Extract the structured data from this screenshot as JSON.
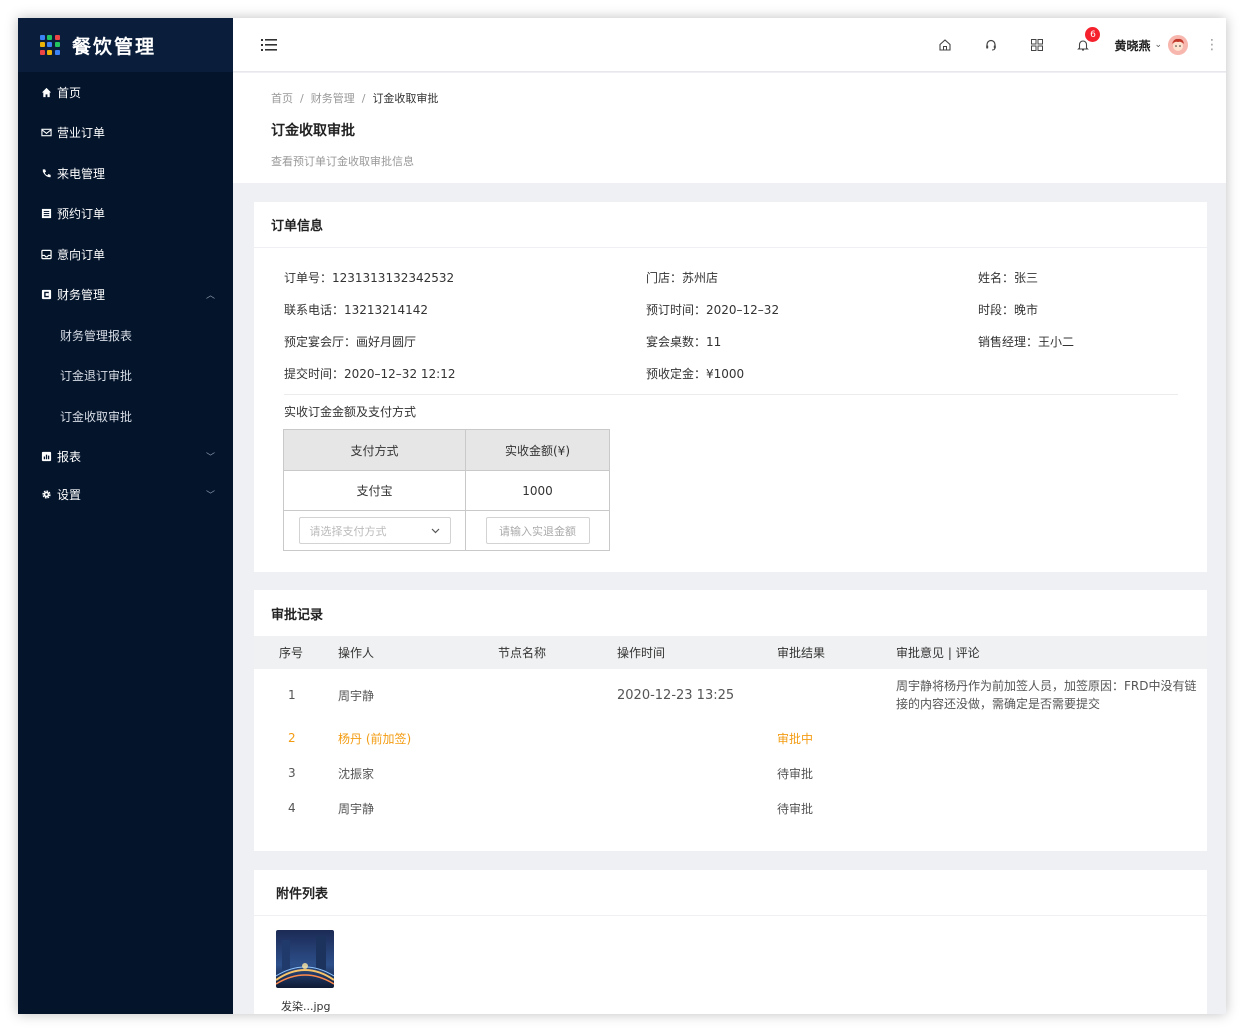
{
  "app": {
    "title": "餐饮管理"
  },
  "sidebar": {
    "items": [
      {
        "label": "首页",
        "icon": "home-icon"
      },
      {
        "label": "营业订单",
        "icon": "mail-icon"
      },
      {
        "label": "来电管理",
        "icon": "phone-icon"
      },
      {
        "label": "预约订单",
        "icon": "list-icon"
      },
      {
        "label": "意向订单",
        "icon": "inbox-icon"
      },
      {
        "label": "财务管理",
        "icon": "finance-icon",
        "expanded": true
      },
      {
        "label": "报表",
        "icon": "chart-icon"
      },
      {
        "label": "设置",
        "icon": "gear-icon"
      }
    ],
    "finance_children": [
      "财务管理报表",
      "订金退订审批",
      "订金收取审批"
    ]
  },
  "header": {
    "notification_count": "6",
    "user_name": "黄晓燕"
  },
  "breadcrumb": {
    "home": "首页",
    "parent": "财务管理",
    "current": "订金收取审批",
    "sep": "/"
  },
  "page": {
    "title": "订金收取审批",
    "description": "查看预订单订金收取审批信息"
  },
  "order_info": {
    "title": "订单信息",
    "fields": {
      "order_no": "订单号：1231313132342532",
      "store": "门店：苏州店",
      "name": "姓名：张三",
      "phone": "联系电话：13213214142",
      "book_time": "预订时间：2020–12–32",
      "period": "时段：晚市",
      "hall": "预定宴会厅：画好月圆厅",
      "tables": "宴会桌数：11",
      "sales_manager": "销售经理：王小二",
      "submit_time": "提交时间：2020–12–32 12:12",
      "deposit": "预收定金：¥1000"
    },
    "pay_caption": "实收订金金额及支付方式",
    "pay_table": {
      "headers": [
        "支付方式",
        "实收金额(¥)"
      ],
      "row": [
        "支付宝",
        "1000"
      ],
      "select_placeholder": "请选择支付方式",
      "amount_placeholder": "请输入实退金额"
    }
  },
  "approval": {
    "title": "审批记录",
    "headers": [
      "序号",
      "操作人",
      "节点名称",
      "操作时间",
      "审批结果",
      "审批意见 | 评论"
    ],
    "rows": [
      {
        "no": "1",
        "operator": "周宇静",
        "node": "",
        "time": "2020-12-23 13:25",
        "result": "",
        "comment": "周宇静将杨丹作为前加签人员，加签原因：FRD中没有链接的内容还没做，需确定是否需要提交"
      },
      {
        "no": "2",
        "operator": "杨丹 (前加签)",
        "node": "",
        "time": "",
        "result": "审批中",
        "comment": ""
      },
      {
        "no": "3",
        "operator": "沈振家",
        "node": "",
        "time": "",
        "result": "待审批",
        "comment": ""
      },
      {
        "no": "4",
        "operator": "周宇静",
        "node": "",
        "time": "",
        "result": "待审批",
        "comment": ""
      }
    ],
    "highlight_color": "#f39c12"
  },
  "attachments": {
    "title": "附件列表",
    "files": [
      {
        "name": "发染...jpg"
      }
    ]
  },
  "colors": {
    "sidebar_bg": "#03142b",
    "brand_bg": "#0a1e3c",
    "badge": "#f5222d",
    "accent_orange": "#f39c12"
  }
}
